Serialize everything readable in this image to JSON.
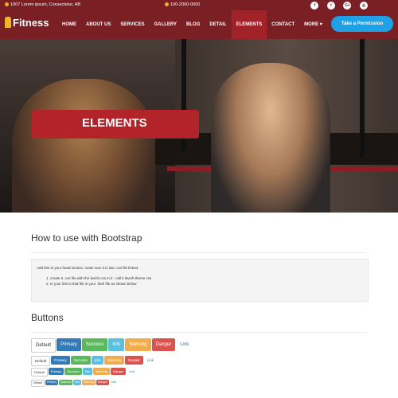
{
  "topbar": {
    "address": "1007 Lorem ipsum, Consectetur, AB",
    "phone": "100-2000-0000",
    "social": [
      "f",
      "t",
      "G+",
      "◎"
    ]
  },
  "nav": {
    "logo": "Fitness",
    "items": [
      "HOME",
      "ABOUT US",
      "SERVICES",
      "GALLERY",
      "BLOG",
      "DETAIL",
      "ELEMENTS",
      "CONTACT",
      "MORE ▾"
    ],
    "active_index": 6,
    "cta": "Take a Permission"
  },
  "hero": {
    "title": "ELEMENTS"
  },
  "bootstrap": {
    "heading": "How to use with Bootstrap",
    "intro": "Add this to your head section, make sure it is last .css file linked.",
    "steps": [
      "1. create a .css file with the lavish.css in it - call it lavish-theme.css",
      "2. In your link to that file in your .html file as shown below"
    ]
  },
  "buttons": {
    "heading": "Buttons",
    "labels": [
      "Default",
      "Primary",
      "Success",
      "Info",
      "Warning",
      "Danger",
      "Link"
    ]
  },
  "colors": {
    "brand": "#7a1f24",
    "active": "#a12329",
    "cta": "#1ea1e6",
    "banner": "#b3232a"
  }
}
